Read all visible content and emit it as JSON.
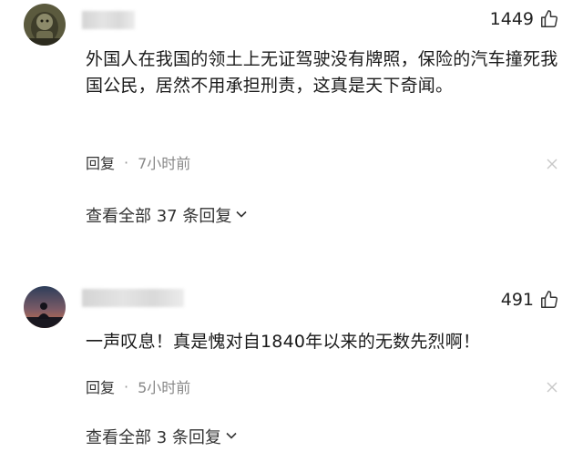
{
  "comments": [
    {
      "likes": "1449",
      "text": "外国人在我国的领土上无证驾驶没有牌照，保险的汽车撞死我国公民，居然不用承担刑责，这真是天下奇闻。",
      "reply_label": "回复",
      "separator": "·",
      "time": "7小时前",
      "view_replies": "查看全部 37 条回复"
    },
    {
      "likes": "491",
      "text": "一声叹息！真是愧对自1840年以来的无数先烈啊！",
      "reply_label": "回复",
      "separator": "·",
      "time": "5小时前",
      "view_replies": "查看全部 3 条回复"
    }
  ],
  "icons": {
    "like": "thumbs-up-icon",
    "close": "close-icon",
    "expand": "chevron-down-icon"
  },
  "colors": {
    "text": "#1a1a1a",
    "meta": "#888888",
    "close": "#c8c8c8"
  }
}
